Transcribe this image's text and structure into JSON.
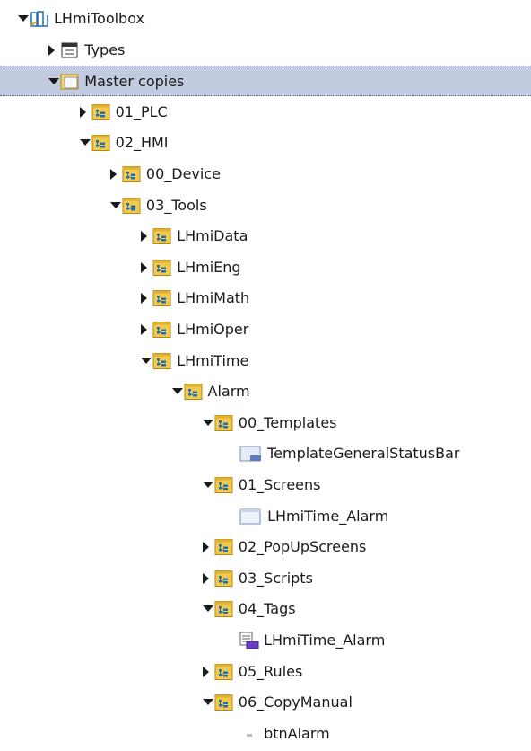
{
  "tree": [
    {
      "label": "LHmiToolbox",
      "icon": "library-icon",
      "state": "expanded",
      "level": 0
    },
    {
      "label": "Types",
      "icon": "types-icon",
      "state": "collapsed",
      "level": 1
    },
    {
      "label": "Master copies",
      "icon": "master-copies-folder-icon",
      "state": "expanded",
      "level": 1,
      "selected": true
    },
    {
      "label": "01_PLC",
      "icon": "group-folder-icon",
      "state": "collapsed",
      "level": 2
    },
    {
      "label": "02_HMI",
      "icon": "group-folder-icon",
      "state": "expanded",
      "level": 2
    },
    {
      "label": "00_Device",
      "icon": "group-folder-icon",
      "state": "collapsed",
      "level": 3
    },
    {
      "label": "03_Tools",
      "icon": "group-folder-icon",
      "state": "expanded",
      "level": 3
    },
    {
      "label": "LHmiData",
      "icon": "group-folder-icon",
      "state": "collapsed",
      "level": 4
    },
    {
      "label": "LHmiEng",
      "icon": "group-folder-icon",
      "state": "collapsed",
      "level": 4
    },
    {
      "label": "LHmiMath",
      "icon": "group-folder-icon",
      "state": "collapsed",
      "level": 4
    },
    {
      "label": "LHmiOper",
      "icon": "group-folder-icon",
      "state": "collapsed",
      "level": 4
    },
    {
      "label": "LHmiTime",
      "icon": "group-folder-icon",
      "state": "expanded",
      "level": 4
    },
    {
      "label": "Alarm",
      "icon": "group-folder-icon",
      "state": "expanded",
      "level": 5
    },
    {
      "label": "00_Templates",
      "icon": "group-folder-icon",
      "state": "expanded",
      "level": 6
    },
    {
      "label": "TemplateGeneralStatusBar",
      "icon": "template-icon",
      "state": "leaf",
      "level": 7
    },
    {
      "label": "01_Screens",
      "icon": "group-folder-icon",
      "state": "expanded",
      "level": 6
    },
    {
      "label": "LHmiTime_Alarm",
      "icon": "screen-icon",
      "state": "leaf",
      "level": 7
    },
    {
      "label": "02_PopUpScreens",
      "icon": "group-folder-icon",
      "state": "collapsed",
      "level": 6
    },
    {
      "label": "03_Scripts",
      "icon": "group-folder-icon",
      "state": "collapsed",
      "level": 6
    },
    {
      "label": "04_Tags",
      "icon": "group-folder-icon",
      "state": "expanded",
      "level": 6
    },
    {
      "label": "LHmiTime_Alarm",
      "icon": "tag-table-icon",
      "state": "leaf",
      "level": 7
    },
    {
      "label": "05_Rules",
      "icon": "group-folder-icon",
      "state": "collapsed",
      "level": 6
    },
    {
      "label": "06_CopyManual",
      "icon": "group-folder-icon",
      "state": "expanded",
      "level": 6
    },
    {
      "label": "btnAlarm",
      "icon": "button-object-icon",
      "state": "leaf",
      "level": 7
    }
  ]
}
